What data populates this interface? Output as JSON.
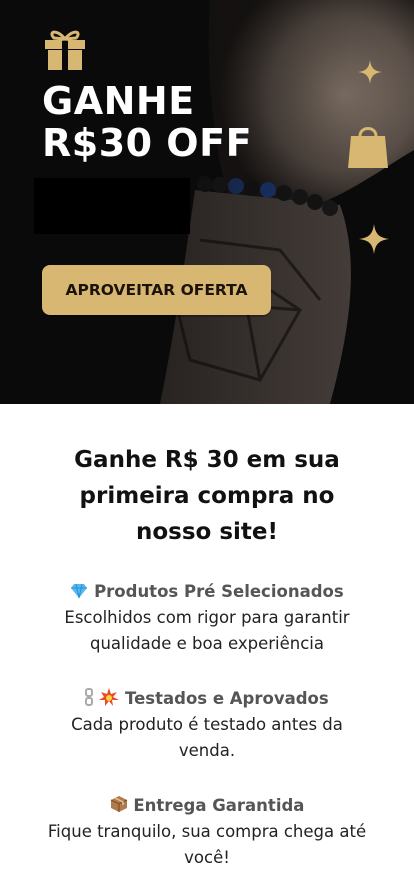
{
  "promo": {
    "line1": "GANHE",
    "line2": "R$30 OFF",
    "cta_label": "APROVEITAR OFERTA"
  },
  "intro": {
    "title": "Ganhe R$ 30 em sua primeira compra no nosso site!"
  },
  "features": [
    {
      "icon": "gem-icon",
      "title": "Produtos Pré Selecionados",
      "desc": "Escolhidos com rigor para garantir qualidade e boa experiência"
    },
    {
      "icon": "link-collision-icon",
      "title": "Testados e Aprovados",
      "desc": "Cada produto é testado antes da venda."
    },
    {
      "icon": "package-icon",
      "title": "Entrega Garantida",
      "desc": "Fique tranquilo, sua compra chega até você!"
    }
  ],
  "colors": {
    "gold": "#d7b772",
    "hero_bg": "#0b0a0a"
  }
}
